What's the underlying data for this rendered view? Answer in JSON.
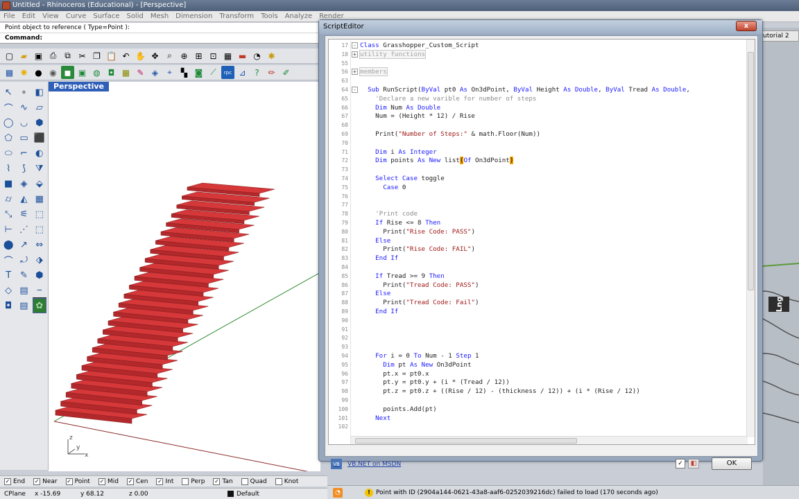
{
  "window": {
    "title": "Untitled - Rhinoceros (Educational) - [Perspective]"
  },
  "menu": [
    "File",
    "Edit",
    "View",
    "Curve",
    "Surface",
    "Solid",
    "Mesh",
    "Dimension",
    "Transform",
    "Tools",
    "Analyze",
    "Render"
  ],
  "command": {
    "history": "Point object to reference ( Type=Point ):",
    "prompt": "Command:"
  },
  "viewport": {
    "label": "Perspective",
    "axis_y": "y",
    "axis_x": "x",
    "axis_z": "z"
  },
  "osnaps": [
    {
      "label": "End",
      "checked": true
    },
    {
      "label": "Near",
      "checked": true
    },
    {
      "label": "Point",
      "checked": true
    },
    {
      "label": "Mid",
      "checked": true
    },
    {
      "label": "Cen",
      "checked": true
    },
    {
      "label": "Int",
      "checked": true
    },
    {
      "label": "Perp",
      "checked": false
    },
    {
      "label": "Tan",
      "checked": true
    },
    {
      "label": "Quad",
      "checked": false
    },
    {
      "label": "Knot",
      "checked": false
    }
  ],
  "status": {
    "cplane": "CPlane",
    "x": "x -15.69",
    "y": "y 68.12",
    "z": "z 0.00",
    "layer": "Default"
  },
  "gh": {
    "tab_label": "utorial 2",
    "lng_label": "Lng",
    "message": "Point with ID (2904a144-0621-43a8-aaf6-0252039216dc) failed to load (170 seconds ago)"
  },
  "script_editor": {
    "title": "ScriptEditor",
    "close_glyph": "x",
    "link_label": "VB.NET on MSDN",
    "link_icon_label": "VB",
    "ok_label": "OK",
    "lines": [
      {
        "n": "17",
        "html": "<span class='kw'>Class</span> Grasshopper_Custom_Script",
        "fold": "-"
      },
      {
        "n": "18",
        "html": "<span class='grey hlbox'>utility functions</span>",
        "fold": "+"
      },
      {
        "n": "55",
        "html": ""
      },
      {
        "n": "56",
        "html": "<span class='grey hlbox'>members</span>",
        "fold": "+"
      },
      {
        "n": "63",
        "html": ""
      },
      {
        "n": "64",
        "html": "  <span class='kw'>Sub</span> RunScript(<span class='kw'>ByVal</span> pt0 <span class='kw'>As</span> On3dPoint, <span class='kw'>ByVal</span> Height <span class='kw'>As Double</span>, <span class='kw'>ByVal</span> Tread <span class='kw'>As Double</span>,",
        "fold": "-"
      },
      {
        "n": "65",
        "html": "    <span class='cm'>'Declare a new varible for number of steps</span>"
      },
      {
        "n": "66",
        "html": "    <span class='kw'>Dim</span> Num <span class='kw'>As Double</span>"
      },
      {
        "n": "67",
        "html": "    Num = (Height * 12) / Rise"
      },
      {
        "n": "68",
        "html": ""
      },
      {
        "n": "69",
        "html": "    Print(<span class='str'>\"Number of Steps:\"</span> &amp; math.Floor(Num))"
      },
      {
        "n": "70",
        "html": ""
      },
      {
        "n": "71",
        "html": "    <span class='kw'>Dim</span> i <span class='kw'>As Integer</span>"
      },
      {
        "n": "72",
        "html": "    <span class='kw'>Dim</span> points <span class='kw'>As New</span> list<span class='brk'>(</span><span class='kw'>Of</span> On3dPoint<span class='brk'>)</span>"
      },
      {
        "n": "73",
        "html": ""
      },
      {
        "n": "74",
        "html": "    <span class='kw'>Select Case</span> toggle"
      },
      {
        "n": "75",
        "html": "      <span class='kw'>Case</span> 0"
      },
      {
        "n": "76",
        "html": ""
      },
      {
        "n": "77",
        "html": ""
      },
      {
        "n": "78",
        "html": "    <span class='cm'>'Print code</span>"
      },
      {
        "n": "79",
        "html": "    <span class='kw'>If</span> Rise &lt;= 8 <span class='kw'>Then</span>"
      },
      {
        "n": "80",
        "html": "      Print(<span class='str'>\"Rise Code: PASS\"</span>)"
      },
      {
        "n": "81",
        "html": "    <span class='kw'>Else</span>"
      },
      {
        "n": "82",
        "html": "      Print(<span class='str'>\"Rise Code: FAIL\"</span>)"
      },
      {
        "n": "83",
        "html": "    <span class='kw'>End If</span>"
      },
      {
        "n": "84",
        "html": ""
      },
      {
        "n": "85",
        "html": "    <span class='kw'>If</span> Tread &gt;= 9 <span class='kw'>Then</span>"
      },
      {
        "n": "86",
        "html": "      Print(<span class='str'>\"Tread Code: PASS\"</span>)"
      },
      {
        "n": "87",
        "html": "    <span class='kw'>Else</span>"
      },
      {
        "n": "88",
        "html": "      Print(<span class='str'>\"Tread Code: Fail\"</span>)"
      },
      {
        "n": "89",
        "html": "    <span class='kw'>End If</span>"
      },
      {
        "n": "90",
        "html": ""
      },
      {
        "n": "91",
        "html": ""
      },
      {
        "n": "92",
        "html": ""
      },
      {
        "n": "93",
        "html": ""
      },
      {
        "n": "94",
        "html": "    <span class='kw'>For</span> i = 0 <span class='kw'>To</span> Num - 1 <span class='kw'>Step</span> 1"
      },
      {
        "n": "95",
        "html": "      <span class='kw'>Dim</span> pt <span class='kw'>As New</span> On3dPoint"
      },
      {
        "n": "96",
        "html": "      pt.x = pt0.x"
      },
      {
        "n": "97",
        "html": "      pt.y = pt0.y + (i * (Tread / 12))"
      },
      {
        "n": "98",
        "html": "      pt.z = pt0.z + ((Rise / 12) - (thickness / 12)) + (i * (Rise / 12))"
      },
      {
        "n": "99",
        "html": ""
      },
      {
        "n": "100",
        "html": "      points.Add(pt)"
      },
      {
        "n": "101",
        "html": "    <span class='kw'>Next</span>"
      },
      {
        "n": "102",
        "html": ""
      }
    ]
  },
  "colors": {
    "tread": "#d6383a",
    "tread_dark": "#8a1f20",
    "viewport_tab": "#2f5fb8",
    "grid_green": "#2d8a2d",
    "grid_red": "#8a2a2a"
  },
  "stair": {
    "tread_count": 26
  }
}
